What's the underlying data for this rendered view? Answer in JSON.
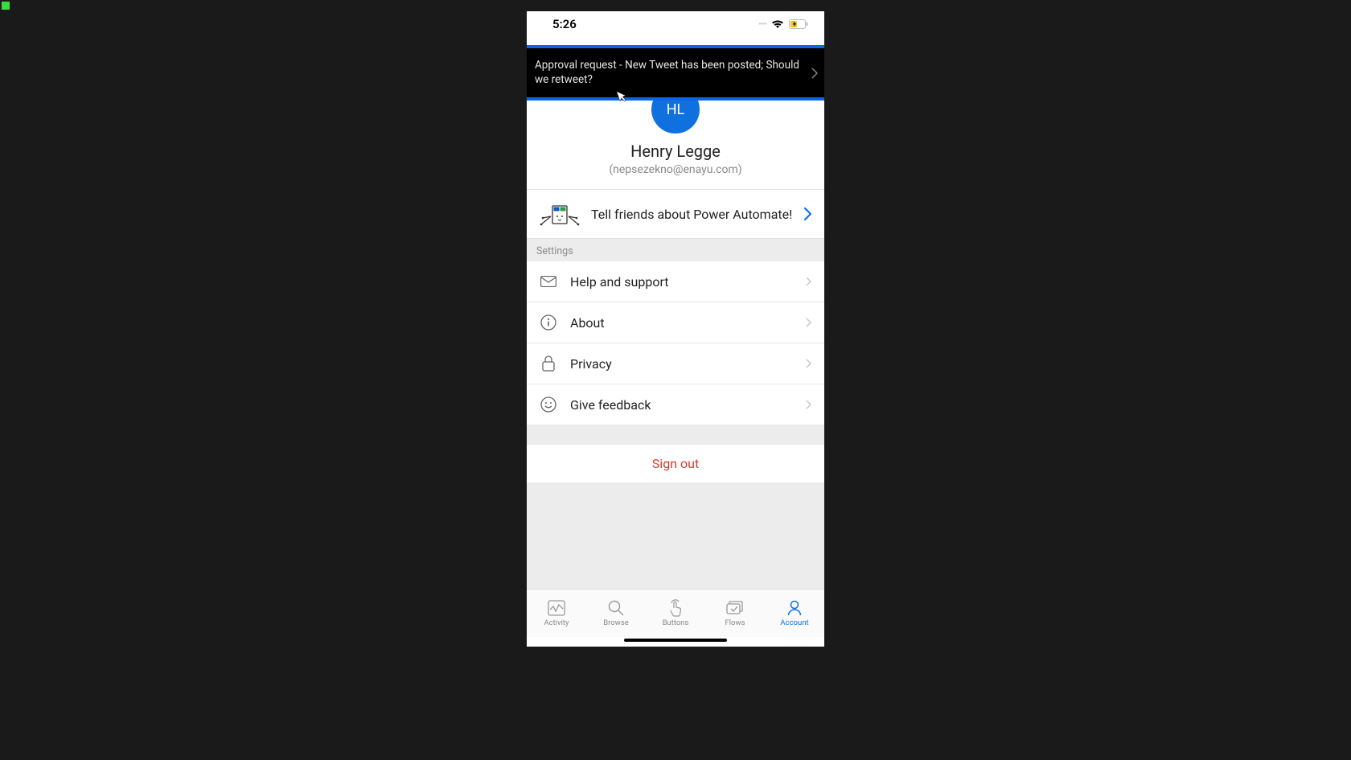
{
  "statusbar": {
    "time": "5:26",
    "carrier_dots": "••••"
  },
  "notification": {
    "text": "Approval request - New Tweet has been posted; Should we retweet?"
  },
  "profile": {
    "initials": "HL",
    "name": "Henry Legge",
    "email": "(nepsezekno@enayu.com)"
  },
  "share": {
    "label": "Tell friends about Power Automate!"
  },
  "sections": {
    "settings_header": "Settings"
  },
  "settings": {
    "help": "Help and support",
    "about": "About",
    "privacy": "Privacy",
    "feedback": "Give feedback"
  },
  "signout": {
    "label": "Sign out"
  },
  "tabs": {
    "activity": "Activity",
    "browse": "Browse",
    "buttons": "Buttons",
    "flows": "Flows",
    "account": "Account"
  },
  "colors": {
    "accent": "#1070e0",
    "highlight_border": "#0a66e6",
    "danger": "#d9362e"
  }
}
